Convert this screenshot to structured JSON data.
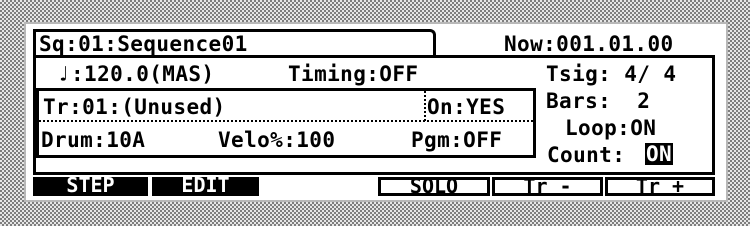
{
  "header": {
    "sequence_label": "Sq:01:Sequence01",
    "now_label": "Now:001.01.00"
  },
  "params": {
    "tempo_icon": "♩",
    "tempo": ":120.0(MAS)",
    "timing": "Timing:OFF",
    "tsig": "Tsig: 4/ 4",
    "bars": "Bars:  2",
    "loop": "Loop:ON",
    "count_label": "Count:",
    "count_value": "ON"
  },
  "track": {
    "track": "Tr:01:(Unused)",
    "on": "On:YES",
    "drum": "Drum:10A",
    "velo": "Velo%:100",
    "pgm": "Pgm:OFF"
  },
  "softkeys": {
    "step": "STEP",
    "edit": "EDIT",
    "solo": "SOLO",
    "tr_minus": "Tr -",
    "tr_plus": "Tr +"
  },
  "colors": {
    "lcd_bg": "#ffffff",
    "ink": "#000000"
  }
}
